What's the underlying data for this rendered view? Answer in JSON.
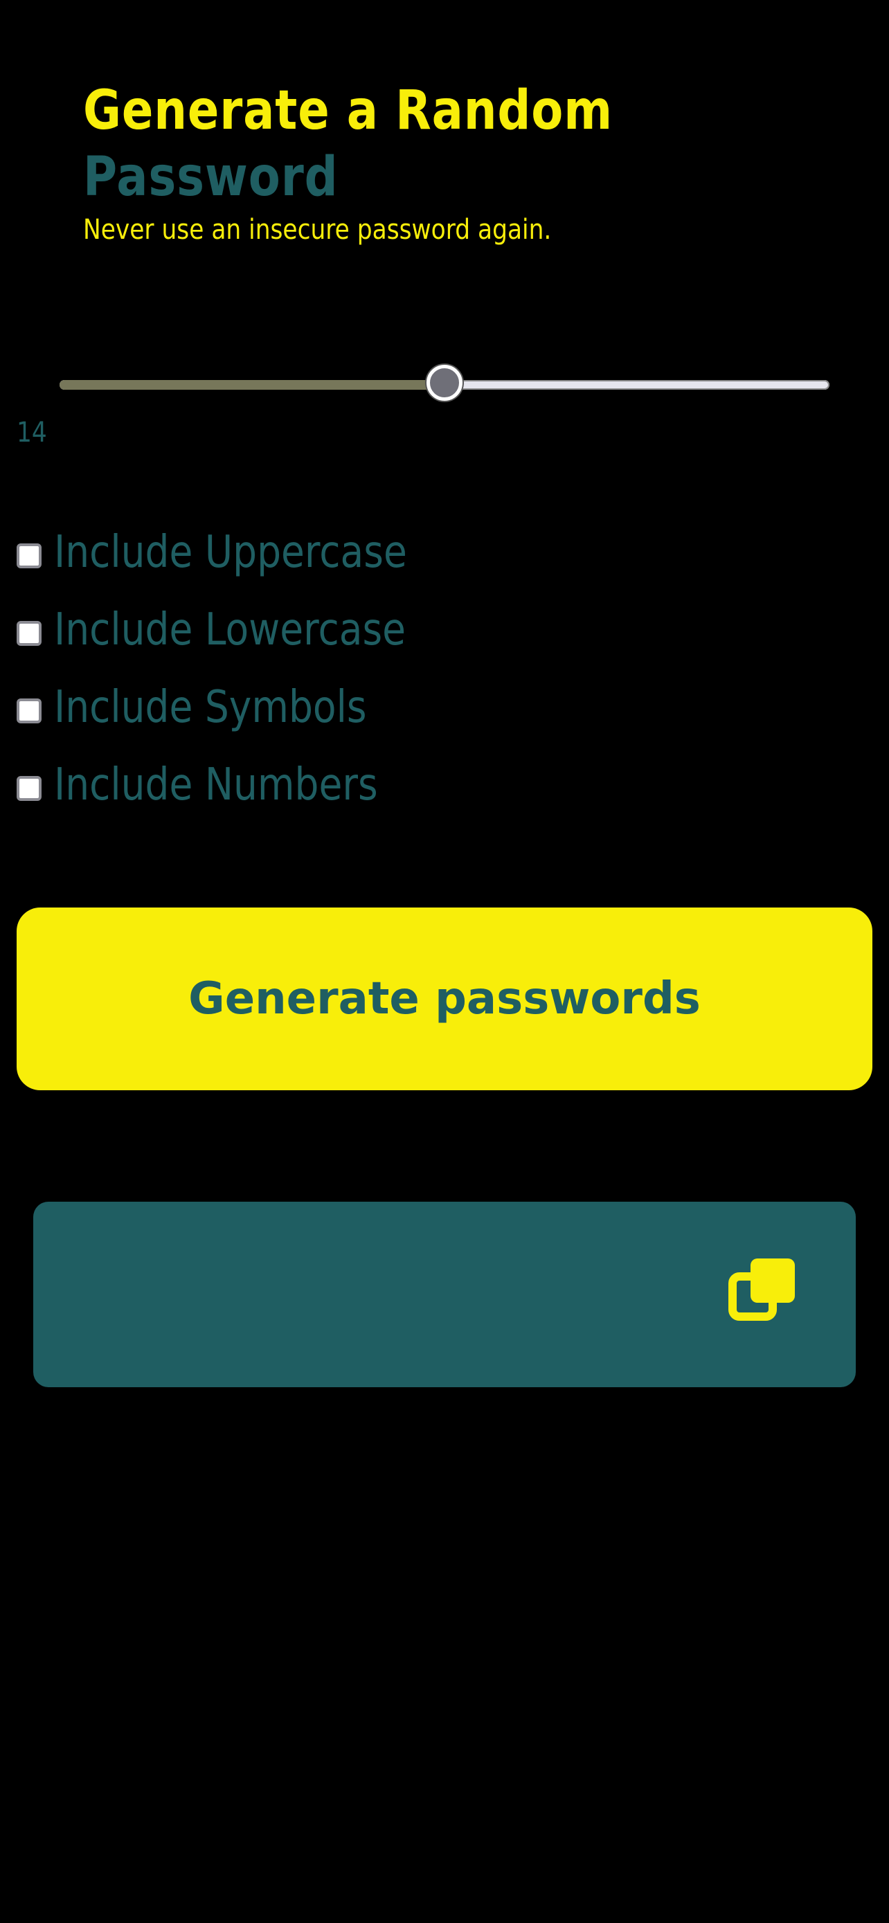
{
  "header": {
    "title_line1": "Generate a Random",
    "title_line2": "Password",
    "subtitle": "Never use an insecure password again."
  },
  "slider": {
    "value": 14,
    "level": 0.5,
    "display_value": "14"
  },
  "options": [
    {
      "label": "Include Uppercase",
      "checked": false
    },
    {
      "label": "Include Lowercase",
      "checked": false
    },
    {
      "label": "Include Symbols",
      "checked": false
    },
    {
      "label": "Include Numbers",
      "checked": false
    }
  ],
  "generate_button": {
    "label": "Generate passwords"
  },
  "output": {
    "password": "",
    "copy_icon": "copy-icon"
  },
  "colors": {
    "background": "#000000",
    "accent_yellow": "#f8ee0a",
    "accent_teal": "#1f5e62",
    "slider_fill": "#77775a"
  }
}
